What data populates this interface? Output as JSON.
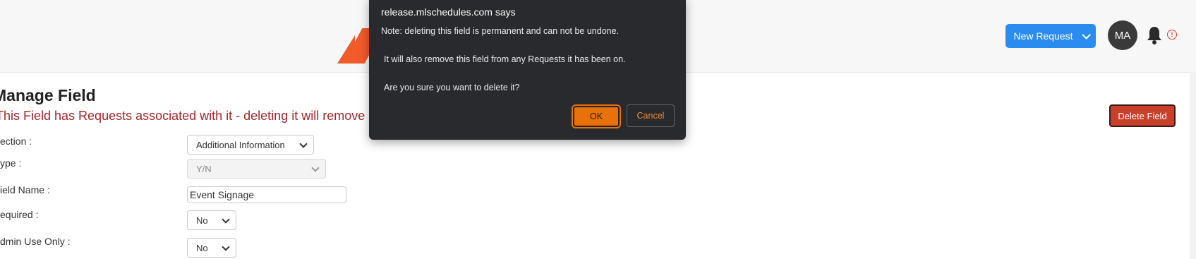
{
  "header": {
    "logo_tail_text": "t",
    "new_request_label": "New Request",
    "avatar_initials": "MA",
    "alert_glyph": "!",
    "brand_color": "#f25a29",
    "button_color": "#2b8cf0"
  },
  "main": {
    "title": "Manage Field",
    "warning": "This Field has Requests associated with it - deleting it will remove",
    "delete_button_label": "Delete Field",
    "form": {
      "section_label": "ection :",
      "section_value": "Additional Information",
      "type_label": "ype :",
      "type_value": "Y/N",
      "field_name_label": "ield Name :",
      "field_name_value": "Event Signage",
      "required_label": "equired :",
      "required_value": "No",
      "admin_only_label": "dmin Use Only :",
      "admin_only_value": "No"
    }
  },
  "dialog": {
    "title": "release.mlschedules.com says",
    "line1": "Note: deleting this field is permanent and can not be undone.",
    "line2": "It will also remove this field from any Requests it has been on.",
    "line3": "Are you sure you want to delete it?",
    "ok_label": "OK",
    "cancel_label": "Cancel",
    "ok_color": "#e8710a"
  }
}
